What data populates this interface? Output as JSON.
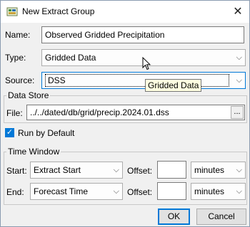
{
  "window": {
    "title": "New Extract Group"
  },
  "form": {
    "name_label": "Name:",
    "name_value": "Observed Gridded Precipitation",
    "type_label": "Type:",
    "type_value": "Gridded Data",
    "source_label": "Source:",
    "source_value": "DSS",
    "source_tooltip": "Gridded Data"
  },
  "data_store": {
    "group_title": "Data Store",
    "file_label": "File:",
    "file_value": "../../dated/db/grid/precip.2024.01.dss",
    "browse_label": "..."
  },
  "run_by_default": {
    "label": "Run by Default",
    "checked": true
  },
  "time_window": {
    "group_title": "Time Window",
    "start_label": "Start:",
    "start_value": "Extract Start",
    "start_offset_label": "Offset:",
    "start_offset_value": "",
    "start_units": "minutes",
    "end_label": "End:",
    "end_value": "Forecast Time",
    "end_offset_label": "Offset:",
    "end_offset_value": "",
    "end_units": "minutes"
  },
  "buttons": {
    "ok": "OK",
    "cancel": "Cancel"
  },
  "colors": {
    "accent": "#0078d7",
    "tooltip_bg": "#ffffe1"
  },
  "icons": {
    "app": "app-icon",
    "close": "close-icon",
    "chevron": "chevron-down-icon",
    "check": "check-icon"
  }
}
